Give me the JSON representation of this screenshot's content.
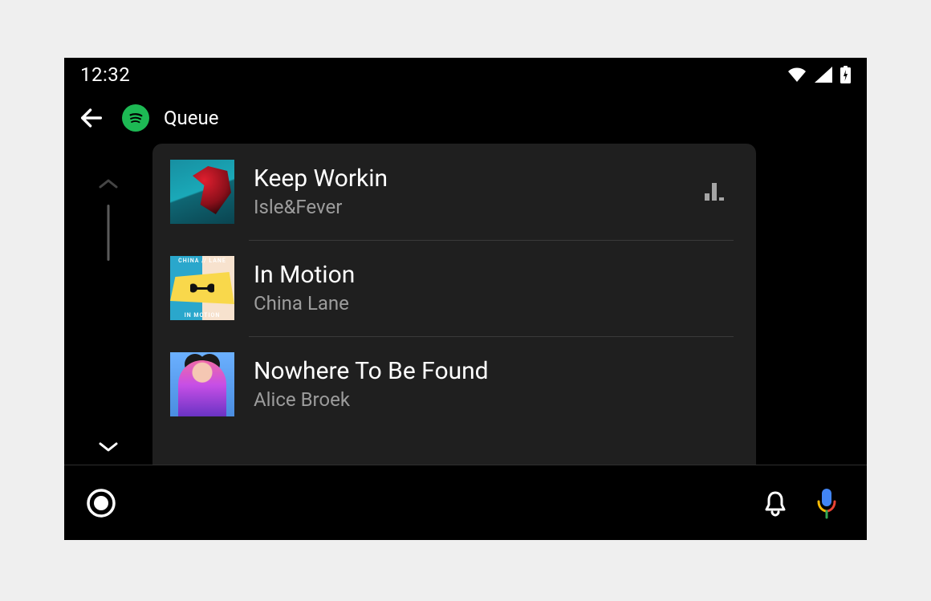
{
  "status": {
    "time": "12:32"
  },
  "header": {
    "title": "Queue"
  },
  "album2_labels": {
    "top": "CHINA // LANE",
    "bottom": "IN MOTION"
  },
  "queue": {
    "tracks": [
      {
        "title": "Keep Workin",
        "artist": "Isle&Fever",
        "playing": true
      },
      {
        "title": "In Motion",
        "artist": "China Lane",
        "playing": false
      },
      {
        "title": "Nowhere To Be Found",
        "artist": "Alice Broek",
        "playing": false
      }
    ]
  }
}
